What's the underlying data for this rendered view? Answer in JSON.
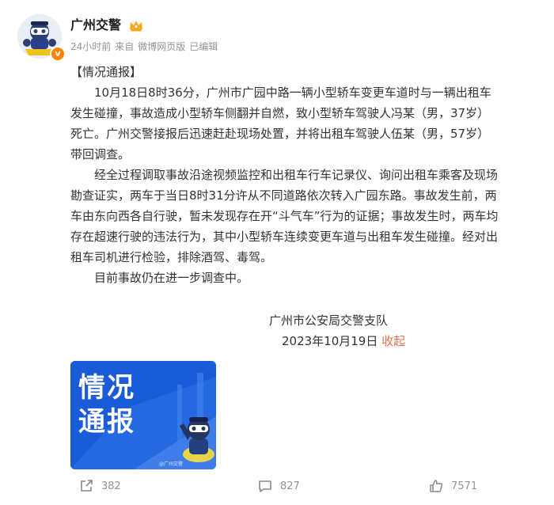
{
  "post": {
    "author": "广州交警",
    "meta": {
      "time": "24小时前",
      "from": "来自",
      "source": "微博网页版",
      "edited": "已编辑"
    },
    "body": {
      "heading": "【情况通报】",
      "p1_line1": "10月18日8时36分，广州市广园中路一辆小型轿车变更车道时与一辆出租车",
      "p1_line2": "发生碰撞，事故造成小型轿车侧翻并自燃，致小型轿车驾驶人冯某（男，37岁）",
      "p1_line3": "死亡。广州交警接报后迅速赶赴现场处置，并将出租车驾驶人伍某（男，57岁）",
      "p1_line4": "带回调查。",
      "p2_line1": "经全过程调取事故沿途视频监控和出租车行车记录仪、询问出租车乘客及现场",
      "p2_line2": "勘查证实，两车于当日8时31分许从不同道路依次转入广园东路。事故发生前，两",
      "p2_line3": "车由东向西各自行驶，暂未发现存在开“斗气车”行为的证据；事故发生时，两车均",
      "p2_line4": "存在超速行驶的违法行为，其中小型轿车连续变更车道与出租车发生碰撞。经对出",
      "p2_line5": "租车司机进行检验，排除酒驾、毒驾。",
      "p3": "目前事故仍在进一步调查中。",
      "signature_org": "广州市公安局交警支队",
      "signature_date": "2023年10月19日",
      "collapse_label": "收起"
    },
    "image": {
      "title_line1": "情况",
      "title_line2": "通报",
      "footer": "@广州交警"
    },
    "actions": {
      "repost_count": "382",
      "comment_count": "827",
      "like_count": "7571"
    },
    "icons": {
      "verified": "verified-v-badge",
      "crown": "crown-icon",
      "repost": "repost-icon",
      "comment": "comment-icon",
      "like": "like-icon"
    },
    "colors": {
      "accent": "#eb7350",
      "meta_gray": "#939393",
      "image_blue": "#1a5bd8",
      "badge_orange": "#ff8200",
      "crown_gold": "#f5a623"
    }
  }
}
